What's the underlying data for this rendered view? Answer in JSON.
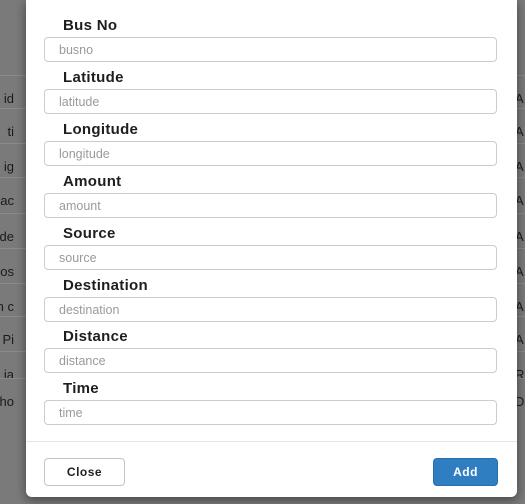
{
  "background": {
    "left_fragments": [
      "id",
      "ti",
      "ig",
      "ac",
      "de",
      "os",
      "n c",
      "Pi",
      "ia",
      "ho"
    ],
    "right_fragments": [
      "A",
      "A",
      "A",
      "A",
      "A",
      "A",
      "A",
      "A",
      "R",
      "D"
    ]
  },
  "form": {
    "fields": [
      {
        "label": "Bus No",
        "placeholder": "busno",
        "value": ""
      },
      {
        "label": "Latitude",
        "placeholder": "latitude",
        "value": ""
      },
      {
        "label": "Longitude",
        "placeholder": "longitude",
        "value": ""
      },
      {
        "label": "Amount",
        "placeholder": "amount",
        "value": ""
      },
      {
        "label": "Source",
        "placeholder": "source",
        "value": ""
      },
      {
        "label": "Destination",
        "placeholder": "destination",
        "value": ""
      },
      {
        "label": "Distance",
        "placeholder": "distance",
        "value": ""
      },
      {
        "label": "Time",
        "placeholder": "time",
        "value": ""
      }
    ]
  },
  "footer": {
    "close_label": "Close",
    "add_label": "Add"
  },
  "colors": {
    "backdrop": "#7b7b7b",
    "primary_button": "#2f7ec1",
    "input_border": "#cccccc"
  }
}
